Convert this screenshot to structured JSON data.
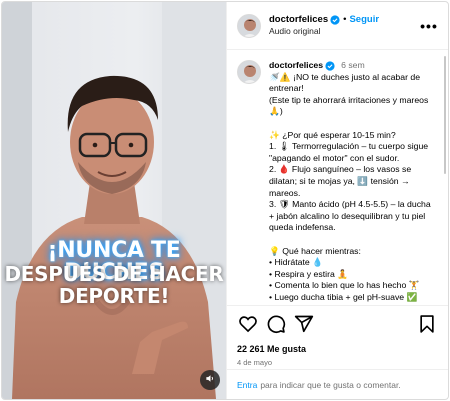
{
  "post": {
    "username": "doctorfelices",
    "follow_label": "Seguir",
    "audio_label": "Audio original",
    "more_label": "•••",
    "overlay": {
      "line1": "¡NUNCA TE DUCHES",
      "line2": "DESPUÉS DE HACER",
      "line3": "DEPORTE!"
    },
    "caption": {
      "username": "doctorfelices",
      "time": "6 sem",
      "lines": [
        "🚿⚠️ ¡NO te duches justo al acabar de",
        "entrenar!",
        "(Este tip te ahorrará irritaciones y mareos",
        "🙏)",
        "",
        "✨ ¿Por qué esperar 10-15 min?",
        "1. 🌡 Termorregulación – tu cuerpo sigue",
        "\"apagando el motor\" con el sudor.",
        "2. 🩸 Flujo sanguíneo – los vasos se",
        "dilatan; si te mojas ya, ⬇️ tensión →",
        "mareos.",
        "3. 🛡 Manto ácido (pH 4.5-5.5) – la ducha",
        "+ jabón alcalino lo desequilibran y tu piel",
        "queda indefensa.",
        "",
        "💡 Qué hacer mientras:",
        "• Hidrátate 💧",
        "• Respira y estira 🧘",
        "• Comenta lo bien que lo has hecho 🏋️",
        "• Luego ducha tibia + gel pH-suave ✅"
      ]
    },
    "likes": "22 261 Me gusta",
    "date": "4 de mayo",
    "comment": {
      "link": "Entra",
      "rest": "para indicar que te gusta o comentar."
    },
    "icons": [
      "heart-icon",
      "comment-icon",
      "share-icon",
      "save-icon",
      "mute-icon",
      "verified-icon"
    ],
    "colors": {
      "accent": "#0095f6",
      "overlay_glow": "#0a84ff",
      "muted_text": "#737373"
    }
  }
}
